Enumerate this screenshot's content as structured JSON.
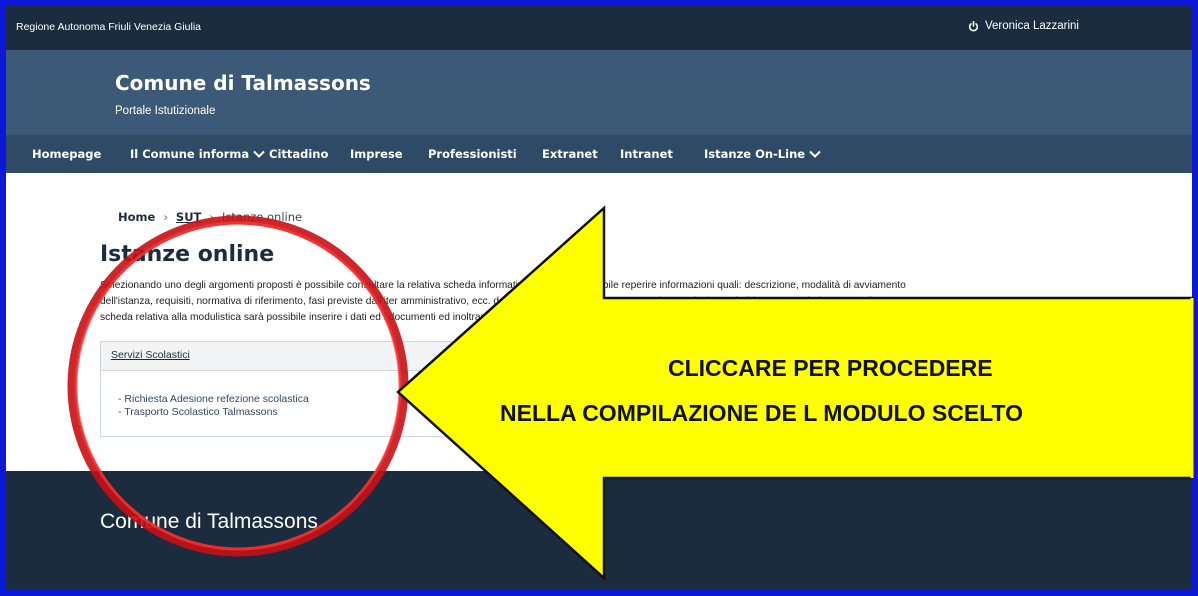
{
  "topbar": {
    "region": "Regione Autonoma Friuli Venezia Giulia",
    "user_name": "Veronica Lazzarini"
  },
  "header": {
    "title": "Comune di Talmassons",
    "subtitle": "Portale Istutizionale"
  },
  "nav": {
    "items": [
      {
        "label": "Homepage"
      },
      {
        "label": "Il Comune informa"
      },
      {
        "label": "Cittadino"
      },
      {
        "label": "Imprese"
      },
      {
        "label": "Professionisti"
      },
      {
        "label": "Extranet"
      },
      {
        "label": "Intranet"
      },
      {
        "label": "Istanze On-Line"
      }
    ]
  },
  "breadcrumb": {
    "home": "Home",
    "sut": "SUT",
    "current": "Istanze online"
  },
  "main": {
    "title": "Istanze online",
    "intro_1": "Selezionando uno degli argomenti proposti è possibile consultare la relativa scheda informativa dove sarà possibile reperire informazioni quali: descrizione, modalità di avviamento",
    "intro_2": "dell'istanza, requisiti, normativa di riferimento, fasi previste dall'iter amministrativo, ecc. da consultare. Attraverso questa sezione, selezionando il bottone \"Invia istanza\" nella",
    "intro_3": "scheda relativa alla modulistica sarà possibile inserire i dati ed i documenti ed inoltrare l'istanza.",
    "panel": {
      "heading": "Servizi Scolastici",
      "items": [
        "- Richiesta Adesione refezione scolastica",
        "- Trasporto Scolastico Talmassons"
      ]
    }
  },
  "footer": {
    "title": "Comune di Talmassons"
  },
  "callout": {
    "line1": "CLICCARE PER PROCEDERE",
    "line2": "NELLA COMPILAZIONE DE L MODULO SCELTO",
    "fill_color": "#ffff00",
    "circle_color": "#e8161b"
  },
  "colors": {
    "frame": "#0b18d8",
    "topbar": "#1b2c3e",
    "header": "#3c5a77",
    "nav": "#2f4a65"
  }
}
